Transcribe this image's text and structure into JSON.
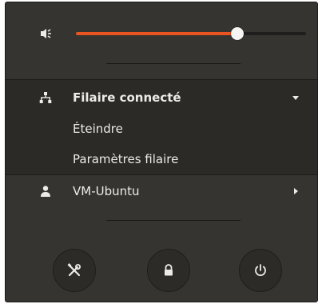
{
  "volume": {
    "level": 0.7,
    "icon": "audio-volume-icon"
  },
  "network": {
    "title": "Filaire connecté",
    "icon": "wired-network-icon",
    "items": [
      {
        "label": "Éteindre"
      },
      {
        "label": "Paramètres filaire"
      }
    ]
  },
  "user": {
    "name": "VM-Ubuntu",
    "icon": "user-icon"
  },
  "buttons": [
    {
      "icon": "settings-icon"
    },
    {
      "icon": "lock-icon"
    },
    {
      "icon": "power-icon"
    }
  ],
  "colors": {
    "background": "#353430",
    "accent": "#e95420",
    "text": "#ecebe7"
  }
}
